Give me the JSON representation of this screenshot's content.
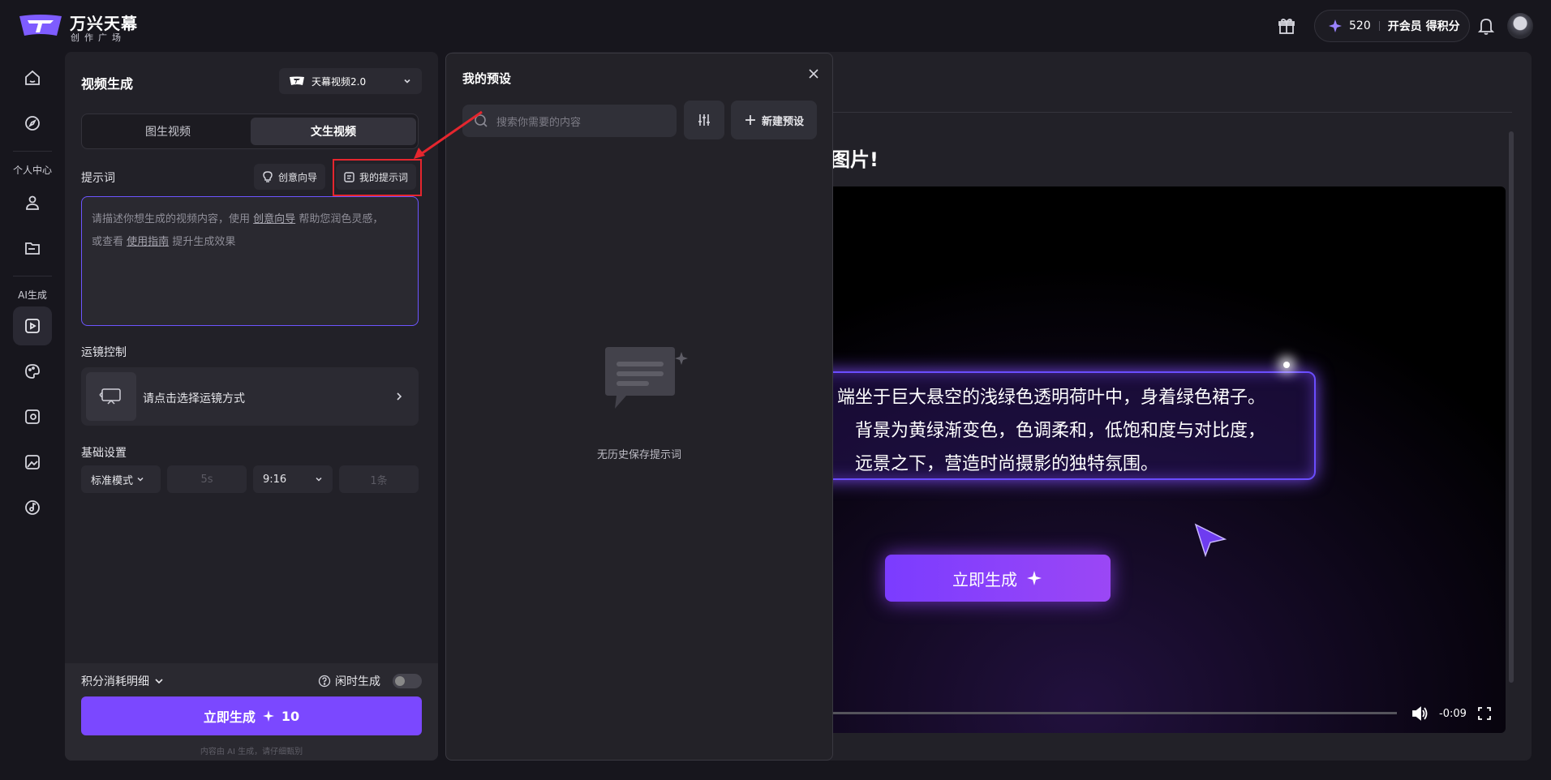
{
  "app": {
    "brand_title": "万兴天幕",
    "brand_sub": "创作广场"
  },
  "topbar": {
    "credits": "520",
    "vip_label": "开会员 得积分"
  },
  "rail": {
    "section_personal": "个人中心",
    "section_ai": "AI生成"
  },
  "panel": {
    "title": "视频生成",
    "model": "天幕视频2.0",
    "tabs": [
      {
        "label": "图生视频",
        "active": false
      },
      {
        "label": "文生视频",
        "active": true
      }
    ],
    "prompt_label": "提示词",
    "guide_chip": "创意向导",
    "my_prompts_chip": "我的提示词",
    "prompt_placeholder": {
      "p1": "请描述你想生成的视频内容，使用",
      "link1": "创意向导",
      "p2": "帮助您润色灵感，",
      "p3": "或查看",
      "link2": "使用指南",
      "p4": "提升生成效果"
    },
    "camera_label": "运镜控制",
    "camera_placeholder": "请点击选择运镜方式",
    "basic_label": "基础设置",
    "settings": {
      "mode": "标准模式",
      "duration": "5s",
      "ratio": "9:16",
      "count": "1条"
    },
    "credit_detail": "积分消耗明细",
    "idle_label": "闲时生成",
    "idle_enabled": false,
    "generate_label": "立即生成",
    "generate_cost": "10",
    "disclaimer": "内容由 AI 生成，请仔细甄别"
  },
  "preset": {
    "title": "我的预设",
    "search_placeholder": "搜索你需要的内容",
    "new_label": "新建预设",
    "empty_text": "无历史保存提示词"
  },
  "main": {
    "heading": "成图片!",
    "video_lines": [
      "端坐于巨大悬空的浅绿色透明荷叶中，身着绿色裙子。",
      "背景为黄绿渐变色，色调柔和，低饱和度与对比度，",
      "远景之下，营造时尚摄影的独特氛围。"
    ],
    "video_button": "立即生成",
    "time": "-0:09"
  },
  "colors": {
    "accent": "#7b48ff",
    "highlight": "#e5262e",
    "bg": "#17161d",
    "panel": "#222128"
  }
}
